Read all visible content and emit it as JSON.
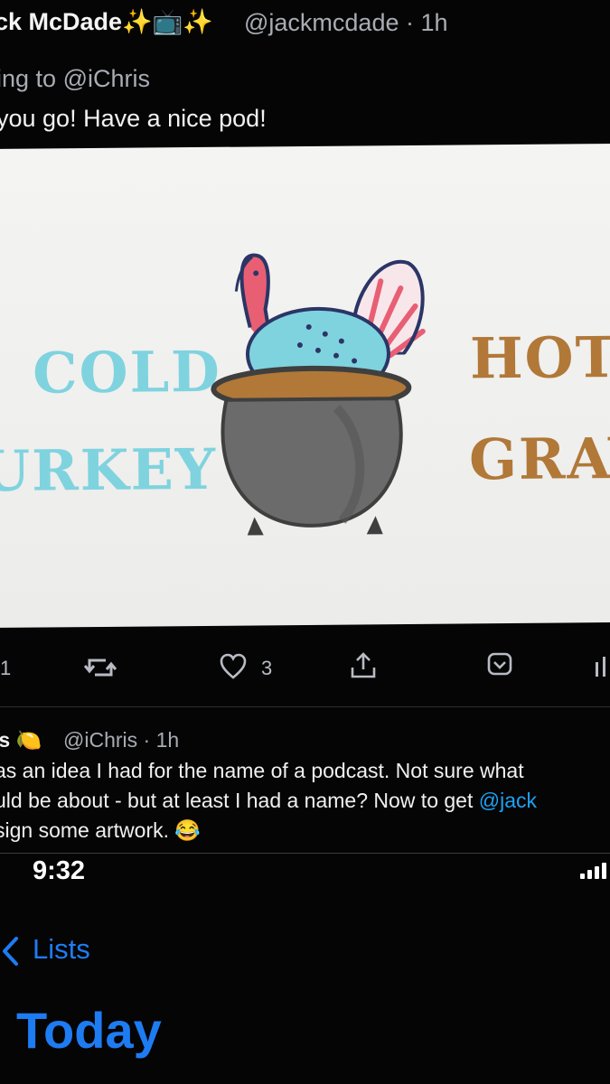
{
  "tweet1": {
    "author": "ck McDade✨📺✨",
    "handle_time": "@jackmcdade · 1h",
    "replying_prefix": "ing to",
    "replying_mention": "@iChris",
    "text": "you go! Have a nice pod!"
  },
  "artwork": {
    "left_line1": "COLD",
    "left_line2": "URKEY",
    "right_line1": "HOT",
    "right_line2": "GRAV",
    "colors": {
      "cold": "#7fd3df",
      "hot": "#b17838",
      "pot": "#6b6b6b",
      "turkey_body": "#7fd3df",
      "turkey_head": "#e85f73"
    },
    "icon": "turkey-in-cauldron"
  },
  "actions": {
    "reply_count": "1",
    "like_count": "3",
    "icons": [
      "retweet-icon",
      "heart-icon",
      "share-icon",
      "bookmark-icon",
      "analytics-icon"
    ]
  },
  "tweet2": {
    "name": "is 🍋",
    "handle_time": "@iChris · 1h",
    "line1": "as an idea I had for the name of a podcast. Not sure what",
    "line2_prefix": "uld be about - but at least I had a name? Now to get ",
    "line2_link": "@jack",
    "line3": "sign some artwork. 😂"
  },
  "phone": {
    "time": "9:32",
    "back_label": "Lists",
    "title": "Today",
    "accent": "#1e7cf2"
  }
}
